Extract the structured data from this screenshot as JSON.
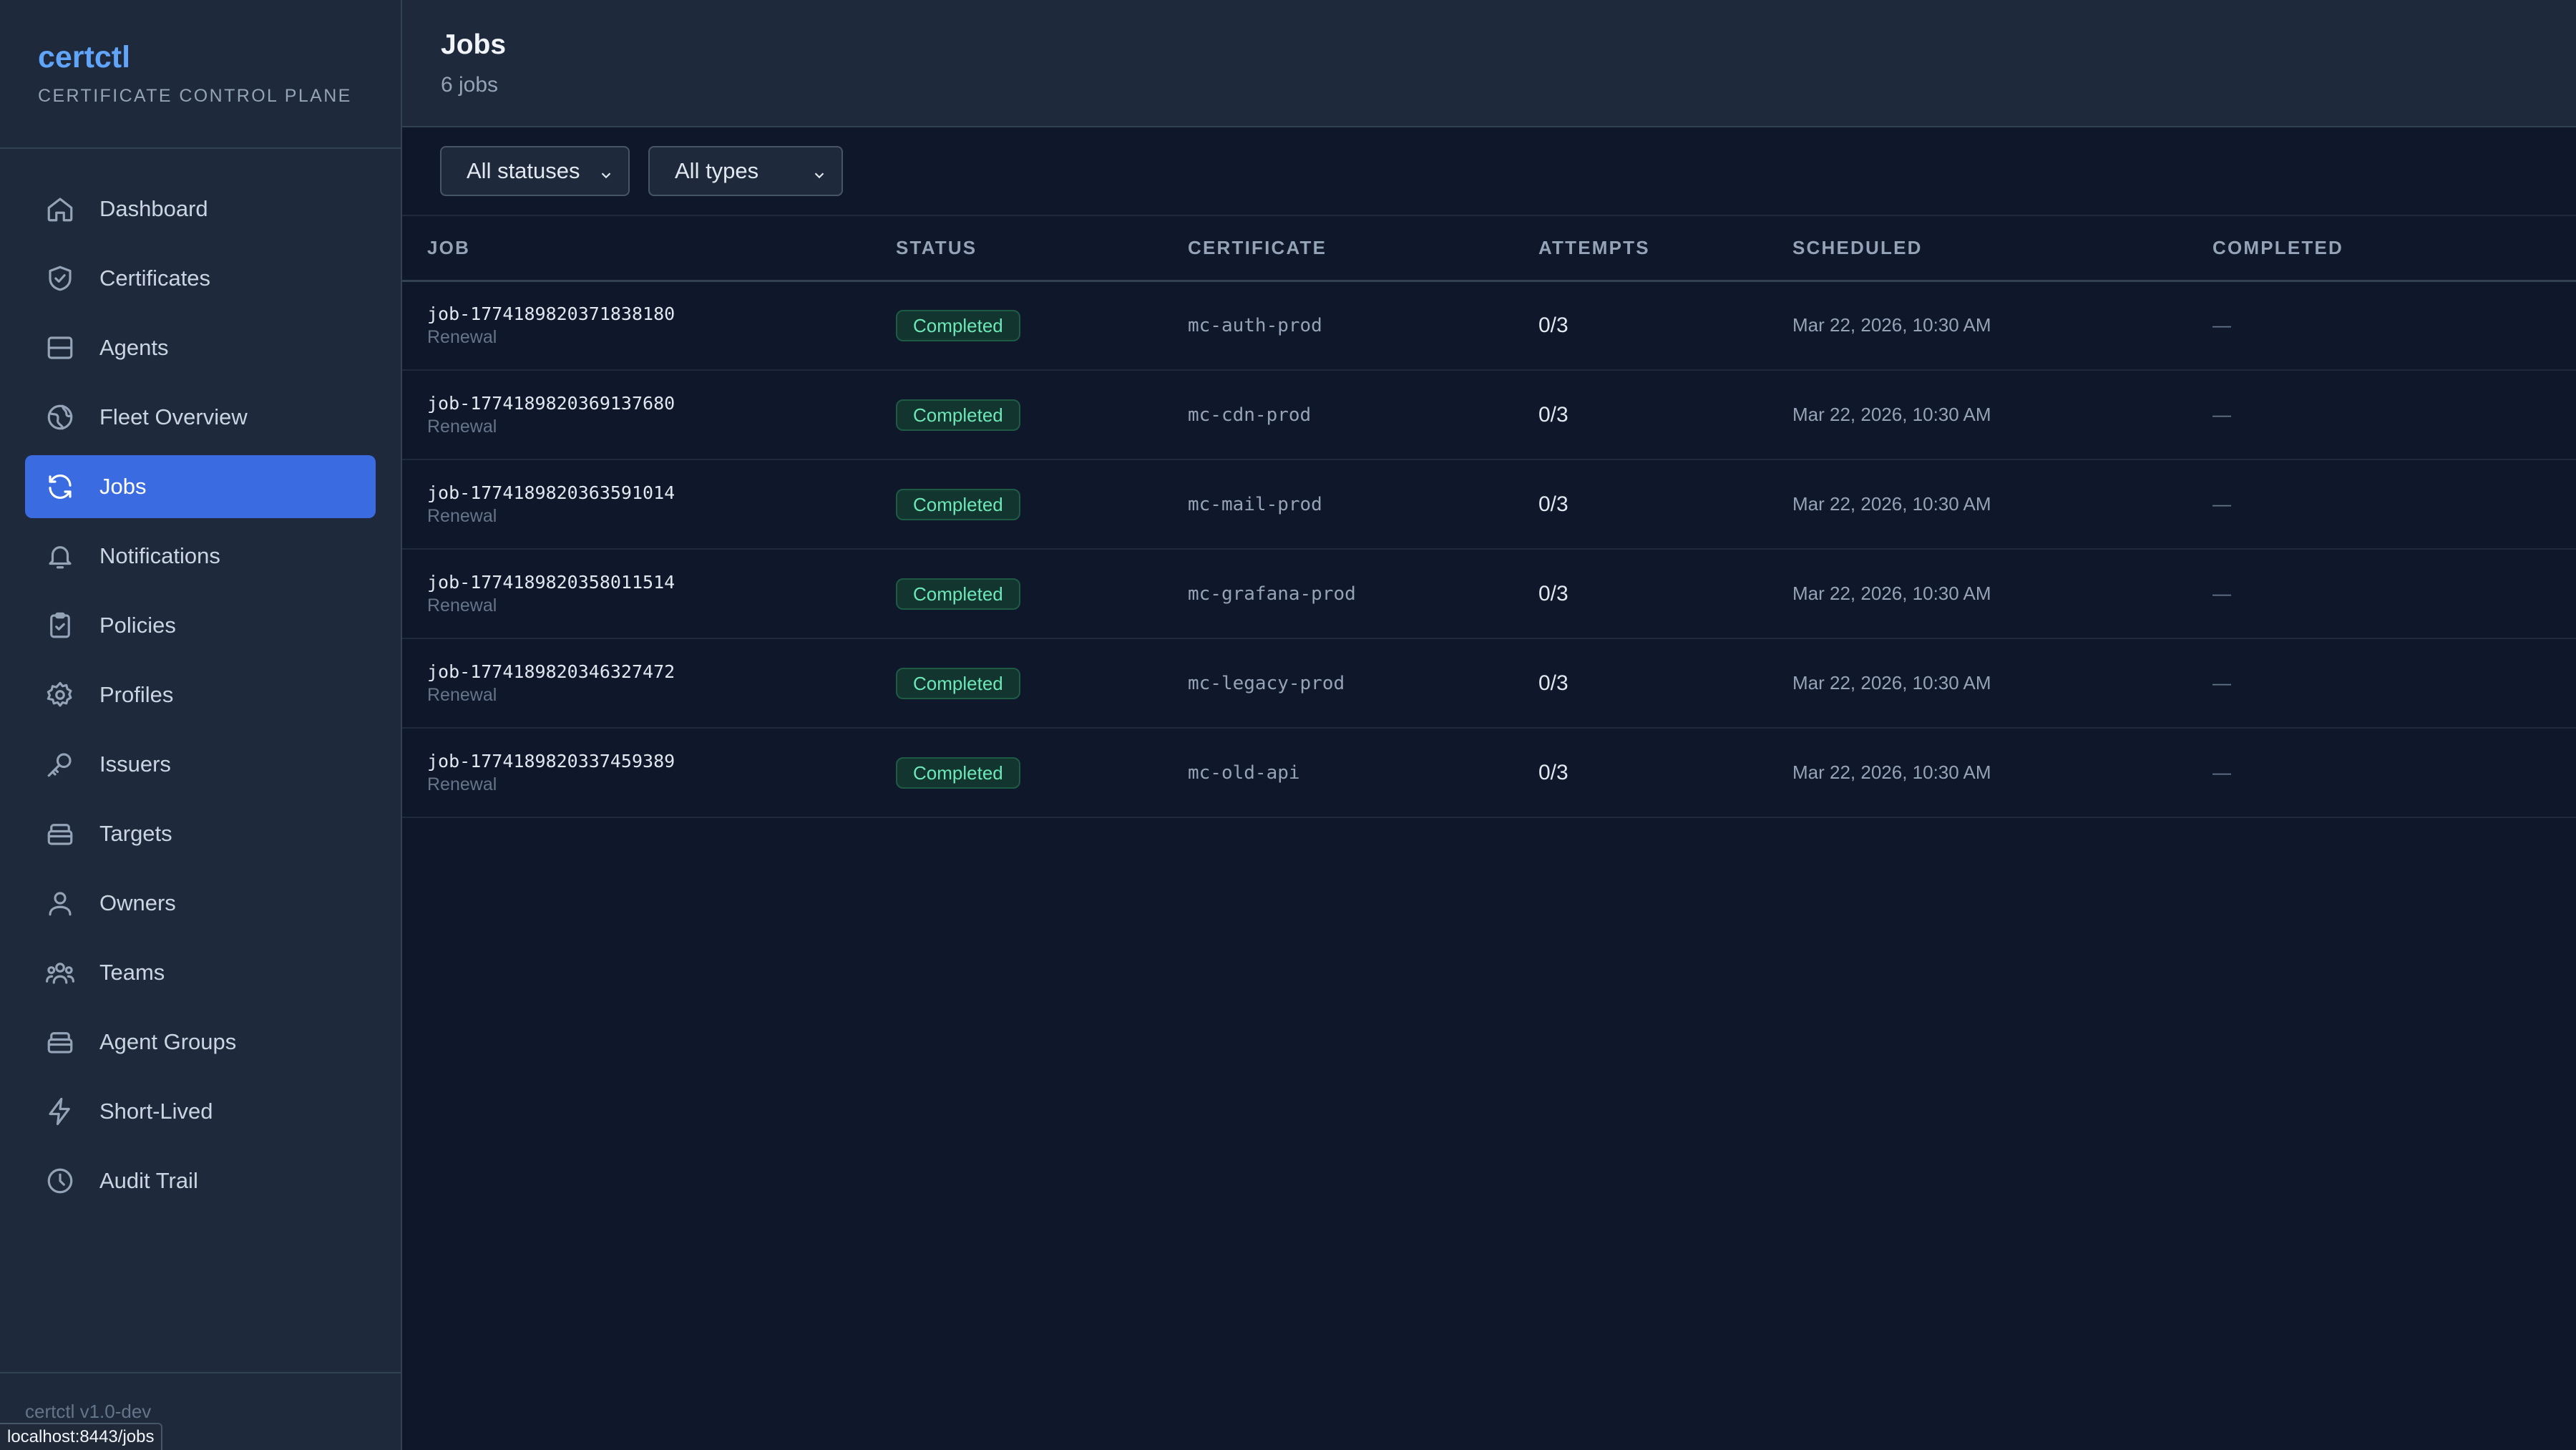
{
  "brand": {
    "name": "certctl",
    "subtitle": "CERTIFICATE CONTROL PLANE"
  },
  "sidebar": {
    "items": [
      {
        "label": "Dashboard",
        "icon": "home-icon"
      },
      {
        "label": "Certificates",
        "icon": "shield-icon"
      },
      {
        "label": "Agents",
        "icon": "server-icon"
      },
      {
        "label": "Fleet Overview",
        "icon": "globe-icon"
      },
      {
        "label": "Jobs",
        "icon": "refresh-icon",
        "active": true
      },
      {
        "label": "Notifications",
        "icon": "bell-icon"
      },
      {
        "label": "Policies",
        "icon": "clipboard-icon"
      },
      {
        "label": "Profiles",
        "icon": "gear-icon"
      },
      {
        "label": "Issuers",
        "icon": "key-icon"
      },
      {
        "label": "Targets",
        "icon": "stack-icon"
      },
      {
        "label": "Owners",
        "icon": "user-icon"
      },
      {
        "label": "Teams",
        "icon": "users-icon"
      },
      {
        "label": "Agent Groups",
        "icon": "layers-icon"
      },
      {
        "label": "Short-Lived",
        "icon": "bolt-icon"
      },
      {
        "label": "Audit Trail",
        "icon": "clock-icon"
      }
    ],
    "footer": "certctl v1.0-dev"
  },
  "header": {
    "title": "Jobs",
    "subtitle": "6 jobs"
  },
  "filters": {
    "status": "All statuses",
    "type": "All types"
  },
  "table": {
    "columns": [
      "JOB",
      "STATUS",
      "CERTIFICATE",
      "ATTEMPTS",
      "SCHEDULED",
      "COMPLETED"
    ],
    "rows": [
      {
        "job": "job-1774189820371838180",
        "type": "Renewal",
        "status": "Completed",
        "certificate": "mc-auth-prod",
        "attempts": "0/3",
        "scheduled": "Mar 22, 2026, 10:30 AM",
        "completed": "—"
      },
      {
        "job": "job-1774189820369137680",
        "type": "Renewal",
        "status": "Completed",
        "certificate": "mc-cdn-prod",
        "attempts": "0/3",
        "scheduled": "Mar 22, 2026, 10:30 AM",
        "completed": "—"
      },
      {
        "job": "job-1774189820363591014",
        "type": "Renewal",
        "status": "Completed",
        "certificate": "mc-mail-prod",
        "attempts": "0/3",
        "scheduled": "Mar 22, 2026, 10:30 AM",
        "completed": "—"
      },
      {
        "job": "job-1774189820358011514",
        "type": "Renewal",
        "status": "Completed",
        "certificate": "mc-grafana-prod",
        "attempts": "0/3",
        "scheduled": "Mar 22, 2026, 10:30 AM",
        "completed": "—"
      },
      {
        "job": "job-1774189820346327472",
        "type": "Renewal",
        "status": "Completed",
        "certificate": "mc-legacy-prod",
        "attempts": "0/3",
        "scheduled": "Mar 22, 2026, 10:30 AM",
        "completed": "—"
      },
      {
        "job": "job-1774189820337459389",
        "type": "Renewal",
        "status": "Completed",
        "certificate": "mc-old-api",
        "attempts": "0/3",
        "scheduled": "Mar 22, 2026, 10:30 AM",
        "completed": "—"
      }
    ]
  },
  "statusbar": {
    "url": "localhost:8443/jobs"
  },
  "colors": {
    "accent": "#3b6be0",
    "brand": "#60a5fa",
    "success": "#6ee7b7",
    "background": "#0f172a",
    "panel": "#1e293b"
  }
}
